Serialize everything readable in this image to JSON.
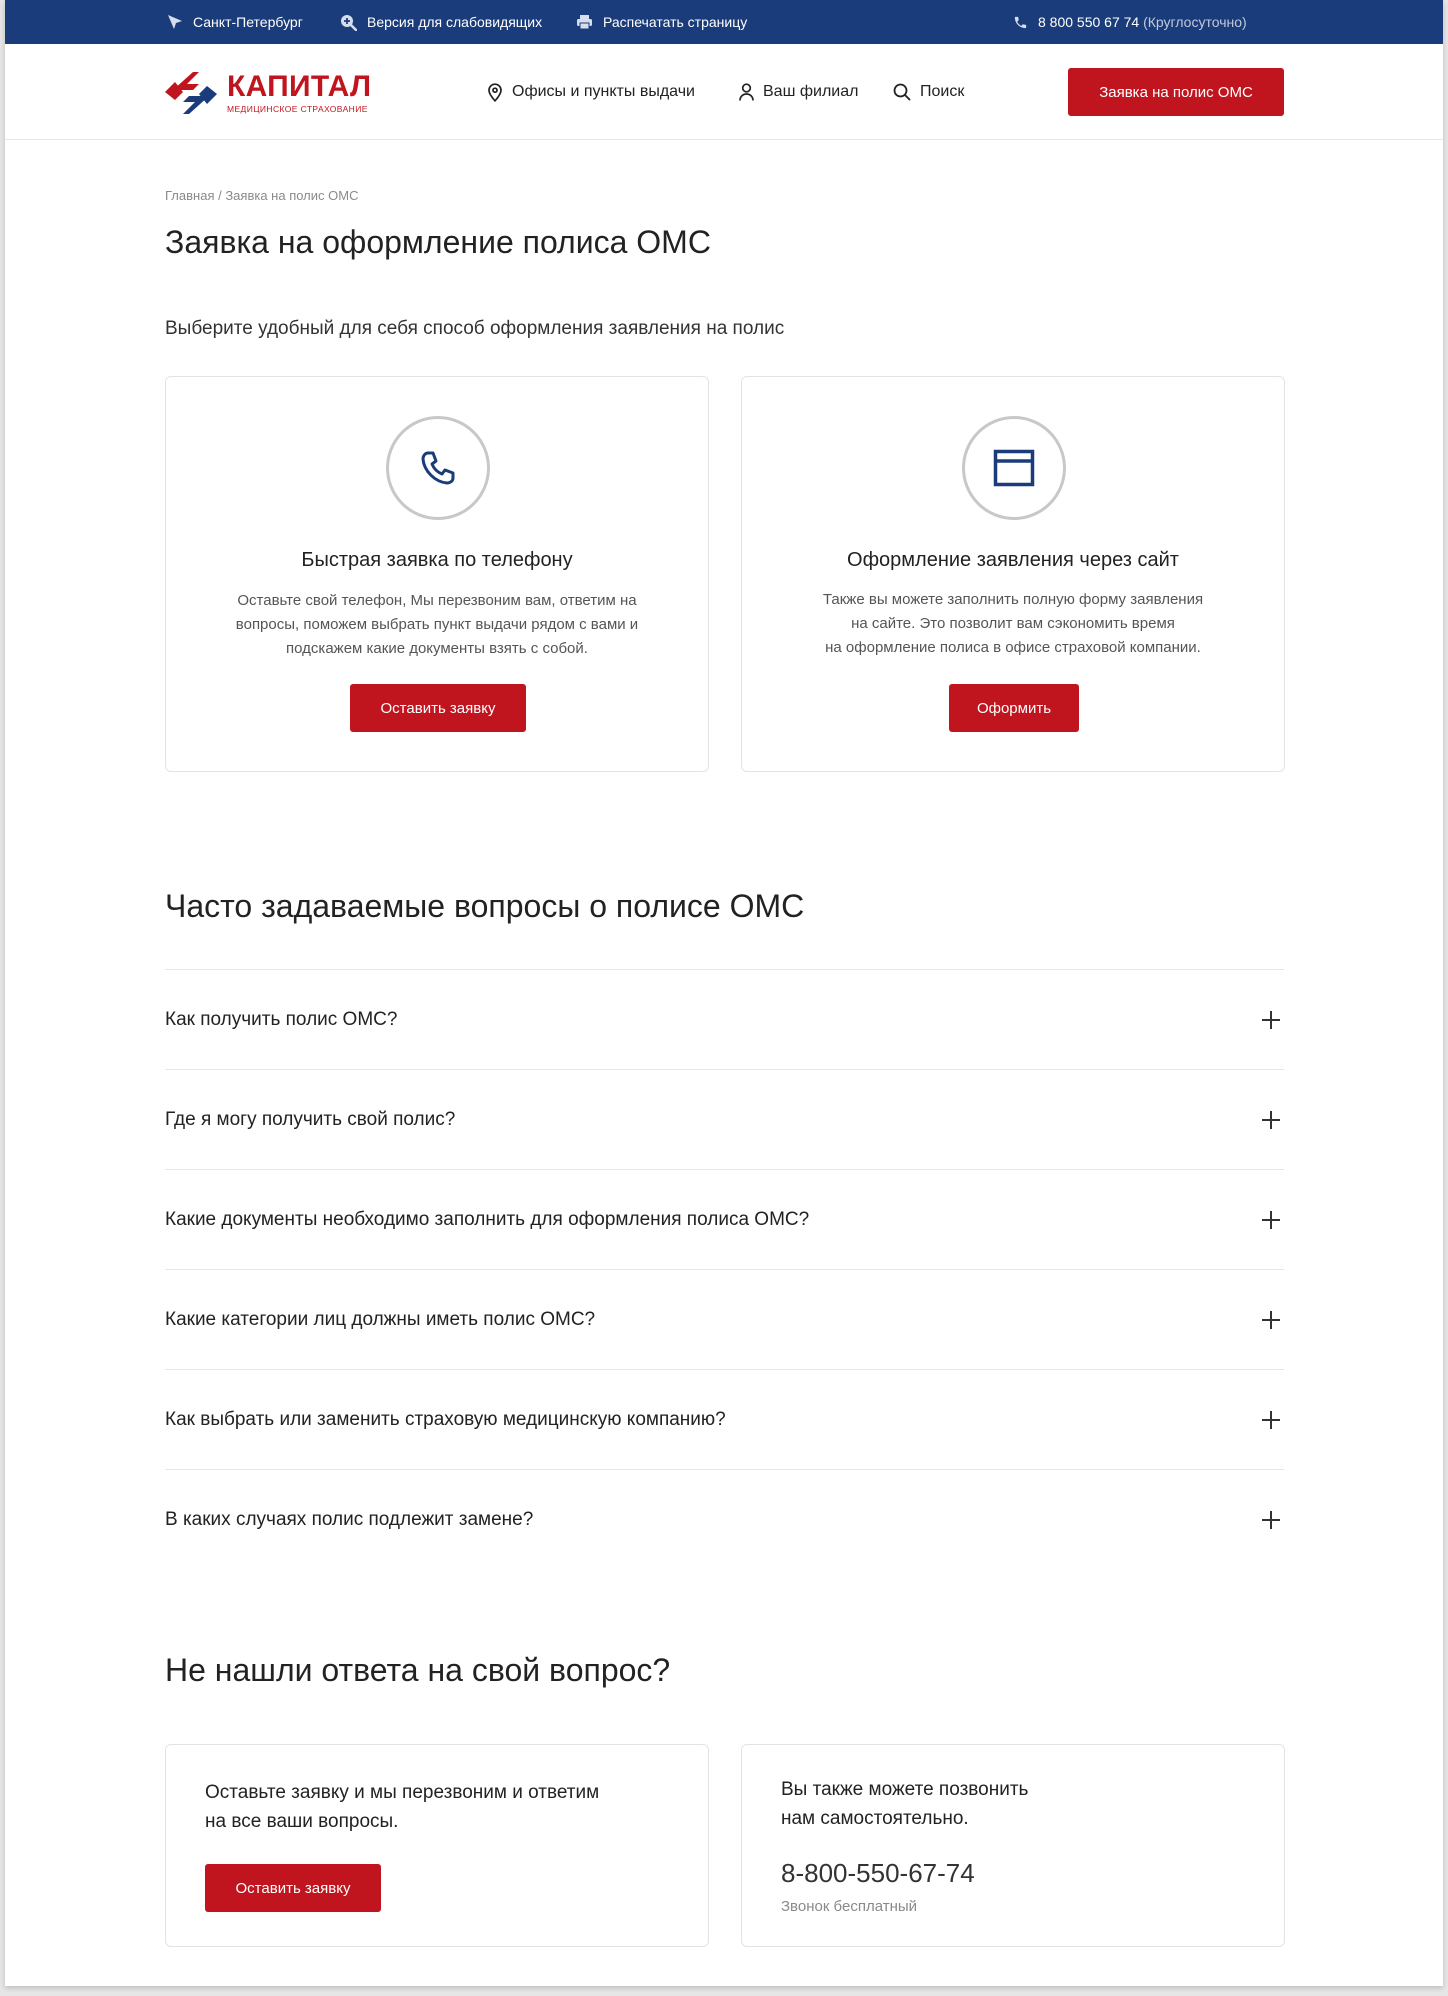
{
  "topbar": {
    "city": "Санкт-Петербург",
    "accessibility": "Версия для слабовидящих",
    "print": "Распечатать страницу",
    "phone": "8 800 550 67 74",
    "phone_hint": "(Круглосуточно)"
  },
  "header": {
    "logo_name": "КАПИТАЛ",
    "logo_sub": "МЕДИЦИНСКОЕ СТРАХОВАНИЕ",
    "nav": {
      "offices": "Офисы и пункты выдачи",
      "branch": "Ваш филиал",
      "search": "Поиск"
    },
    "cta": "Заявка на полис ОМС"
  },
  "breadcrumb": {
    "home": "Главная",
    "separator": " / ",
    "current": "Заявка на полис ОМС"
  },
  "page_title": "Заявка на оформление полиса ОМС",
  "lead": "Выберите удобный для себя способ оформления заявления на полис",
  "options": [
    {
      "icon": "phone-icon",
      "title": "Быстрая заявка по телефону",
      "lines": [
        "Оставьте свой телефон, Мы перезвоним вам, ответим на",
        "вопросы, поможем выбрать пункт выдачи рядом с вами и",
        "подскажем какие документы взять с собой."
      ],
      "button": "Оставить заявку"
    },
    {
      "icon": "browser-window-icon",
      "title": "Оформление заявления через сайт",
      "lines": [
        "Также вы можете заполнить полную форму заявления",
        "на сайте. Это позволит вам сэкономить время",
        "на оформление полиса в офисе страховой компании."
      ],
      "button": "Оформить"
    }
  ],
  "faq": {
    "title": "Часто задаваемые вопросы о полисе ОМС",
    "items": [
      "Как получить полис ОМС?",
      "Где я могу получить свой полис?",
      "Какие документы необходимо заполнить для оформления полиса ОМС?",
      "Какие категории лиц должны иметь полис ОМС?",
      "Как выбрать или заменить страховую медицинскую компанию?",
      "В каких случаях полис подлежит замене?"
    ]
  },
  "help": {
    "title": "Не нашли ответа на свой вопрос?",
    "request_lines": [
      "Оставьте заявку и мы перезвоним и ответим",
      "на все ваши вопросы."
    ],
    "request_button": "Оставить заявку",
    "call_lines": [
      "Вы также можете позвонить",
      "нам самостоятельно."
    ],
    "call_phone": "8-800-550-67-74",
    "call_note": "Звонок бесплатный"
  },
  "colors": {
    "brand_blue": "#1b3c7a",
    "brand_red": "#c0151e"
  }
}
